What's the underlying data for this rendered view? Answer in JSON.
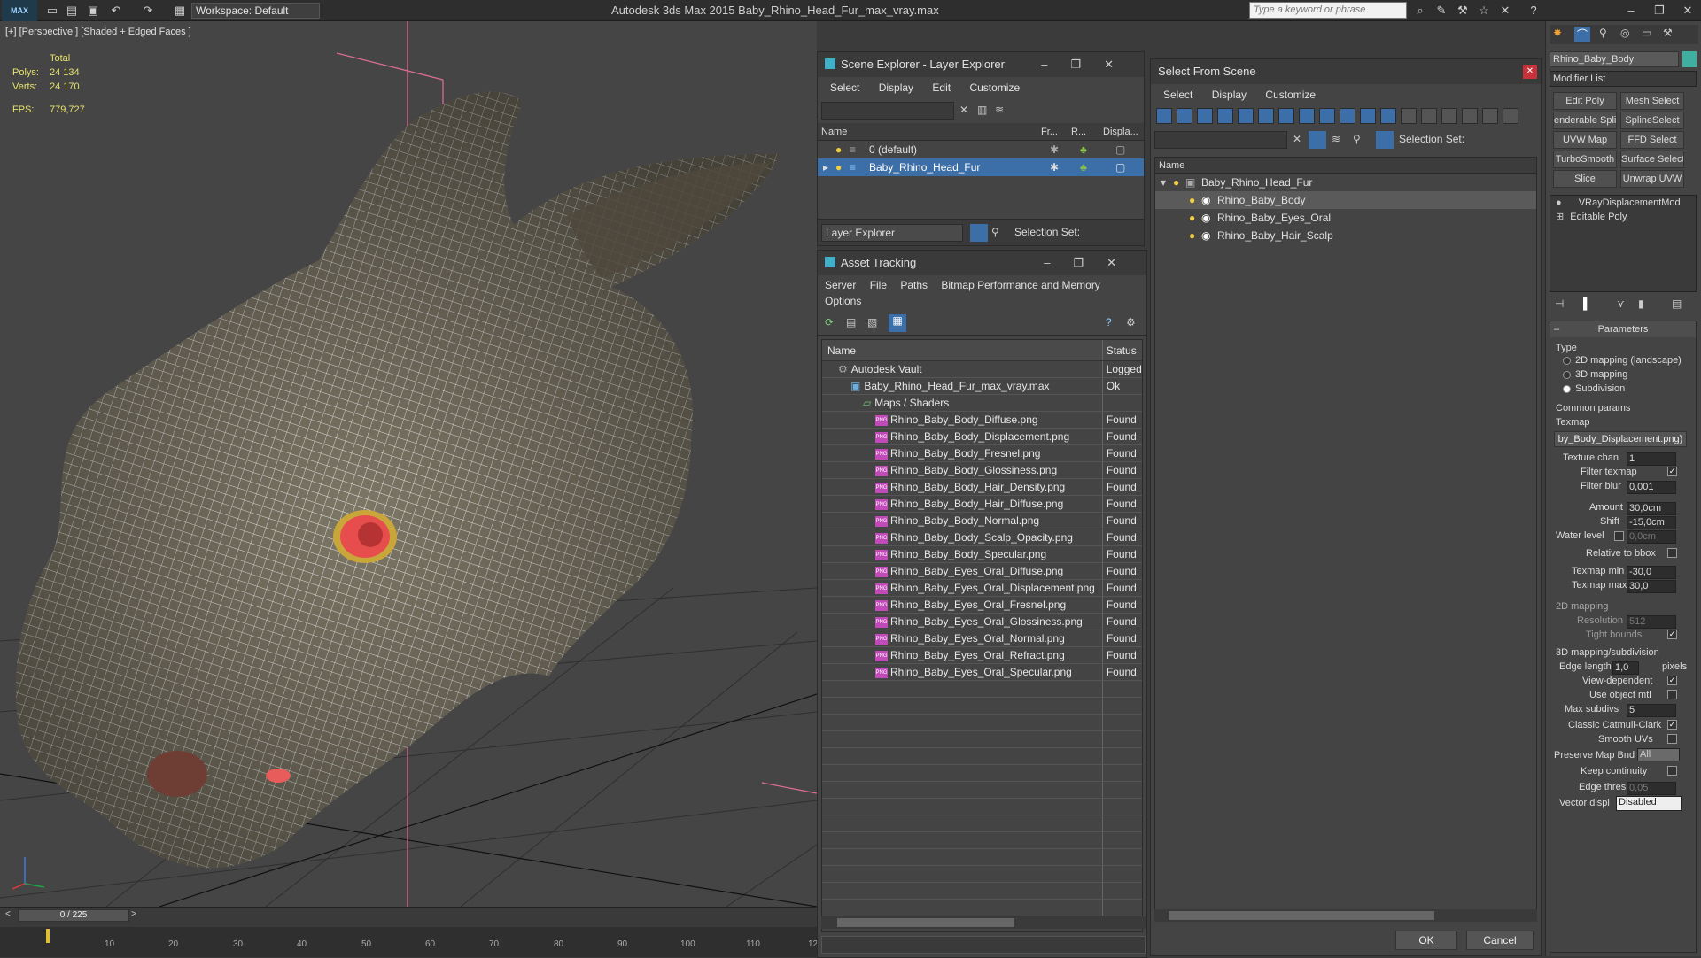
{
  "topbar": {
    "logo": "MAX",
    "workspace": "Workspace: Default",
    "app_title": "Autodesk 3ds Max  2015     Baby_Rhino_Head_Fur_max_vray.max",
    "search_placeholder": "Type a keyword or phrase"
  },
  "viewport": {
    "label": "[+] [Perspective ] [Shaded + Edged Faces ]",
    "stats": {
      "total_label": "Total",
      "polys_label": "Polys:",
      "polys": "24 134",
      "verts_label": "Verts:",
      "verts": "24 170",
      "fps_label": "FPS:",
      "fps": "779,727"
    }
  },
  "timeline": {
    "frame": "0 / 225",
    "ticks": [
      "0",
      "10",
      "20",
      "30",
      "40",
      "50",
      "60",
      "70",
      "80",
      "90",
      "100",
      "110",
      "12"
    ]
  },
  "scene_explorer": {
    "title": "Scene Explorer - Layer Explorer",
    "menu": [
      "Select",
      "Display",
      "Edit",
      "Customize"
    ],
    "columns": [
      "Name",
      "Fr...",
      "R...",
      "Displa..."
    ],
    "rows": [
      {
        "name": "0 (default)",
        "selected": false
      },
      {
        "name": "Baby_Rhino_Head_Fur",
        "selected": true
      }
    ],
    "footer_dropdown": "Layer Explorer",
    "selection_set": "Selection Set:"
  },
  "asset_tracking": {
    "title": "Asset Tracking",
    "menu": [
      "Server",
      "File",
      "Paths",
      "Bitmap Performance and Memory"
    ],
    "menu2": "Options",
    "columns": [
      "Name",
      "Status"
    ],
    "rows": [
      {
        "name": "Autodesk Vault",
        "status": "Logged",
        "indent": 1,
        "icon": "vault"
      },
      {
        "name": "Baby_Rhino_Head_Fur_max_vray.max",
        "status": "Ok",
        "indent": 2,
        "icon": "max"
      },
      {
        "name": "Maps / Shaders",
        "status": "",
        "indent": 3,
        "icon": "folder"
      },
      {
        "name": "Rhino_Baby_Body_Diffuse.png",
        "status": "Found",
        "indent": 4,
        "icon": "png"
      },
      {
        "name": "Rhino_Baby_Body_Displacement.png",
        "status": "Found",
        "indent": 4,
        "icon": "png"
      },
      {
        "name": "Rhino_Baby_Body_Fresnel.png",
        "status": "Found",
        "indent": 4,
        "icon": "png"
      },
      {
        "name": "Rhino_Baby_Body_Glossiness.png",
        "status": "Found",
        "indent": 4,
        "icon": "png"
      },
      {
        "name": "Rhino_Baby_Body_Hair_Density.png",
        "status": "Found",
        "indent": 4,
        "icon": "png"
      },
      {
        "name": "Rhino_Baby_Body_Hair_Diffuse.png",
        "status": "Found",
        "indent": 4,
        "icon": "png"
      },
      {
        "name": "Rhino_Baby_Body_Normal.png",
        "status": "Found",
        "indent": 4,
        "icon": "png"
      },
      {
        "name": "Rhino_Baby_Body_Scalp_Opacity.png",
        "status": "Found",
        "indent": 4,
        "icon": "png"
      },
      {
        "name": "Rhino_Baby_Body_Specular.png",
        "status": "Found",
        "indent": 4,
        "icon": "png"
      },
      {
        "name": "Rhino_Baby_Eyes_Oral_Diffuse.png",
        "status": "Found",
        "indent": 4,
        "icon": "png"
      },
      {
        "name": "Rhino_Baby_Eyes_Oral_Displacement.png",
        "status": "Found",
        "indent": 4,
        "icon": "png"
      },
      {
        "name": "Rhino_Baby_Eyes_Oral_Fresnel.png",
        "status": "Found",
        "indent": 4,
        "icon": "png"
      },
      {
        "name": "Rhino_Baby_Eyes_Oral_Glossiness.png",
        "status": "Found",
        "indent": 4,
        "icon": "png"
      },
      {
        "name": "Rhino_Baby_Eyes_Oral_Normal.png",
        "status": "Found",
        "indent": 4,
        "icon": "png"
      },
      {
        "name": "Rhino_Baby_Eyes_Oral_Refract.png",
        "status": "Found",
        "indent": 4,
        "icon": "png"
      },
      {
        "name": "Rhino_Baby_Eyes_Oral_Specular.png",
        "status": "Found",
        "indent": 4,
        "icon": "png"
      }
    ]
  },
  "select_from_scene": {
    "title": "Select From Scene",
    "menu": [
      "Select",
      "Display",
      "Customize"
    ],
    "selection_set": "Selection Set:",
    "column": "Name",
    "tree": [
      {
        "name": "Baby_Rhino_Head_Fur",
        "level": 0,
        "selected": false
      },
      {
        "name": "Rhino_Baby_Body",
        "level": 1,
        "selected": true
      },
      {
        "name": "Rhino_Baby_Eyes_Oral",
        "level": 1,
        "selected": false
      },
      {
        "name": "Rhino_Baby_Hair_Scalp",
        "level": 1,
        "selected": false
      }
    ],
    "ok": "OK",
    "cancel": "Cancel"
  },
  "command_panel": {
    "object_name": "Rhino_Baby_Body",
    "modifier_list": "Modifier List",
    "buttons": [
      "Edit Poly",
      "Mesh Select",
      "enderable Splir",
      "SplineSelect",
      "UVW Map",
      "FFD Select",
      "TurboSmooth",
      "Surface Select",
      "Slice",
      "Unwrap UVW"
    ],
    "stack": [
      "VRayDisplacementMod",
      "Editable Poly"
    ],
    "parameters": "Parameters",
    "type_label": "Type",
    "types": [
      {
        "label": "2D mapping (landscape)",
        "on": false
      },
      {
        "label": "3D mapping",
        "on": false
      },
      {
        "label": "Subdivision",
        "on": true
      }
    ],
    "common_params": "Common params",
    "texmap_label": "Texmap",
    "texmap": "by_Body_Displacement.png)",
    "texture_chan_label": "Texture chan",
    "texture_chan": "1",
    "filter_texmap": "Filter texmap",
    "filter_blur_label": "Filter blur",
    "filter_blur": "0,001",
    "amount_label": "Amount",
    "amount": "30,0cm",
    "shift_label": "Shift",
    "shift": "-15,0cm",
    "water_level_label": "Water level",
    "water_level": "0,0cm",
    "relative_bbox": "Relative to bbox",
    "texmap_min_label": "Texmap min",
    "texmap_min": "-30,0",
    "texmap_max_label": "Texmap max",
    "texmap_max": "30,0",
    "mapping2d": "2D mapping",
    "resolution_label": "Resolution",
    "resolution": "512",
    "tight_bounds": "Tight bounds",
    "mapping3d": "3D mapping/subdivision",
    "edge_length_label": "Edge length",
    "edge_length": "1,0",
    "pixels": "pixels",
    "view_dependent": "View-dependent",
    "use_object_mtl": "Use object mtl",
    "max_subdivs_label": "Max subdivs",
    "max_subdivs": "5",
    "classic_catmull": "Classic Catmull-Clark",
    "smooth_uvs": "Smooth UVs",
    "preserve_map_bnd": "Preserve Map Bnd",
    "preserve_value": "All",
    "keep_continuity": "Keep continuity",
    "edge_thresh_label": "Edge thresh",
    "edge_thresh": "0,05",
    "vector_displ_label": "Vector displ",
    "vector_displ": "Disabled"
  }
}
